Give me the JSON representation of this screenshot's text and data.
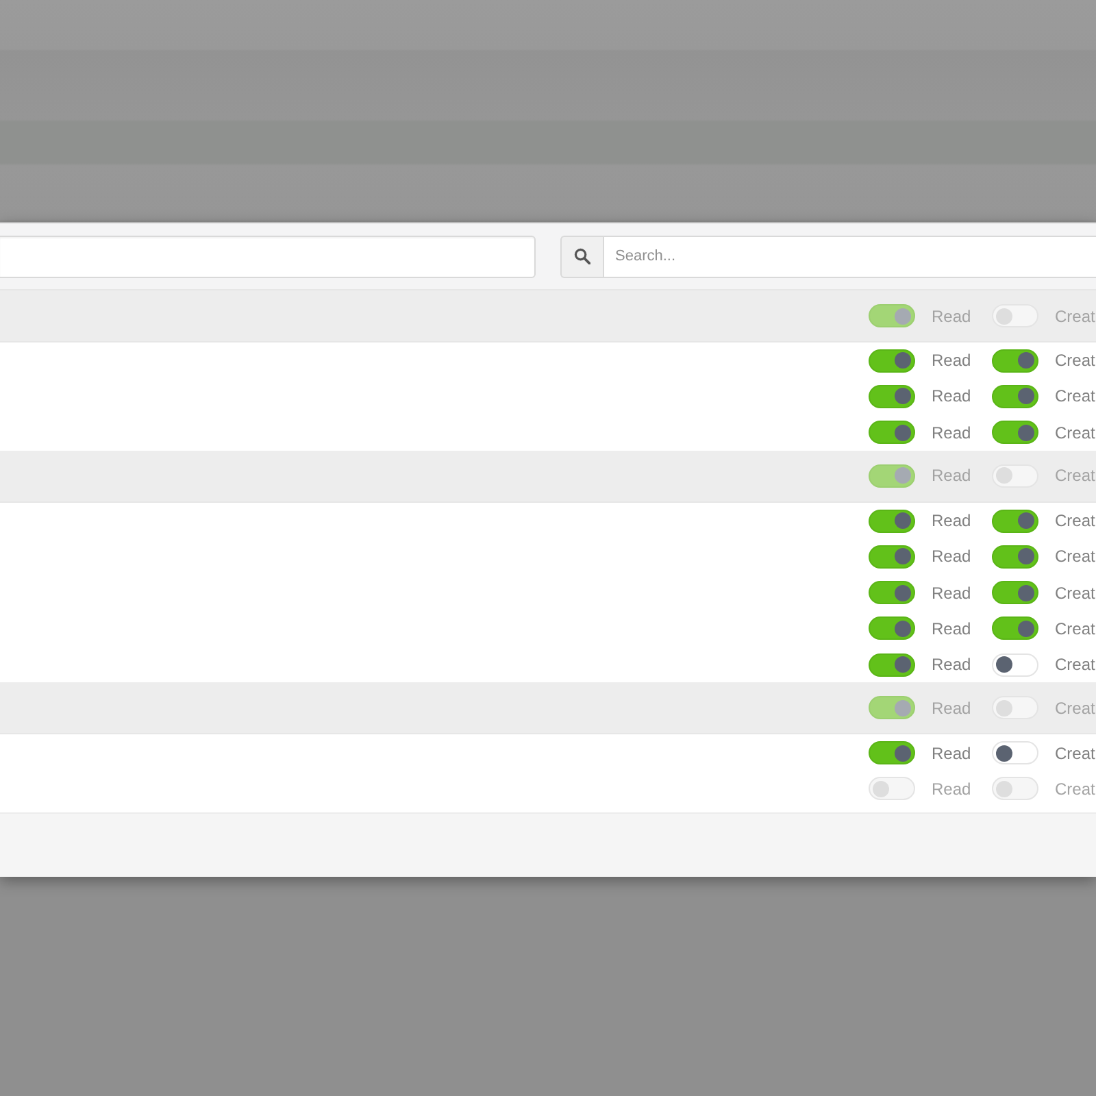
{
  "toolbar": {
    "fields": [
      {
        "kind": "text"
      },
      {
        "kind": "search",
        "placeholder": "Search..."
      }
    ]
  },
  "groups": [
    {
      "header": {
        "permissions": [
          {
            "label": "Read",
            "on": true,
            "disabled": true
          },
          {
            "label": "Creat",
            "on": false,
            "disabled": true
          }
        ]
      },
      "rows": [
        {
          "permissions": [
            {
              "label": "Read",
              "on": true,
              "disabled": false
            },
            {
              "label": "Creat",
              "on": true,
              "disabled": false
            }
          ]
        },
        {
          "permissions": [
            {
              "label": "Read",
              "on": true,
              "disabled": false
            },
            {
              "label": "Creat",
              "on": true,
              "disabled": false
            }
          ]
        },
        {
          "permissions": [
            {
              "label": "Read",
              "on": true,
              "disabled": false
            },
            {
              "label": "Creat",
              "on": true,
              "disabled": false
            }
          ]
        }
      ]
    },
    {
      "header": {
        "permissions": [
          {
            "label": "Read",
            "on": true,
            "disabled": true
          },
          {
            "label": "Creat",
            "on": false,
            "disabled": true
          }
        ]
      },
      "rows": [
        {
          "permissions": [
            {
              "label": "Read",
              "on": true,
              "disabled": false
            },
            {
              "label": "Creat",
              "on": true,
              "disabled": false
            }
          ]
        },
        {
          "permissions": [
            {
              "label": "Read",
              "on": true,
              "disabled": false
            },
            {
              "label": "Creat",
              "on": true,
              "disabled": false
            }
          ]
        },
        {
          "permissions": [
            {
              "label": "Read",
              "on": true,
              "disabled": false
            },
            {
              "label": "Creat",
              "on": true,
              "disabled": false
            }
          ]
        },
        {
          "permissions": [
            {
              "label": "Read",
              "on": true,
              "disabled": false
            },
            {
              "label": "Creat",
              "on": true,
              "disabled": false
            }
          ]
        },
        {
          "permissions": [
            {
              "label": "Read",
              "on": true,
              "disabled": false
            },
            {
              "label": "Creat",
              "on": false,
              "disabled": false
            }
          ]
        }
      ]
    },
    {
      "header": {
        "permissions": [
          {
            "label": "Read",
            "on": true,
            "disabled": true
          },
          {
            "label": "Creat",
            "on": false,
            "disabled": true
          }
        ]
      },
      "rows": [
        {
          "permissions": [
            {
              "label": "Read",
              "on": true,
              "disabled": false
            },
            {
              "label": "Creat",
              "on": false,
              "disabled": false
            }
          ]
        },
        {
          "permissions": [
            {
              "label": "Read",
              "on": false,
              "disabled": true
            },
            {
              "label": "Creat",
              "on": false,
              "disabled": true
            }
          ]
        }
      ]
    }
  ]
}
